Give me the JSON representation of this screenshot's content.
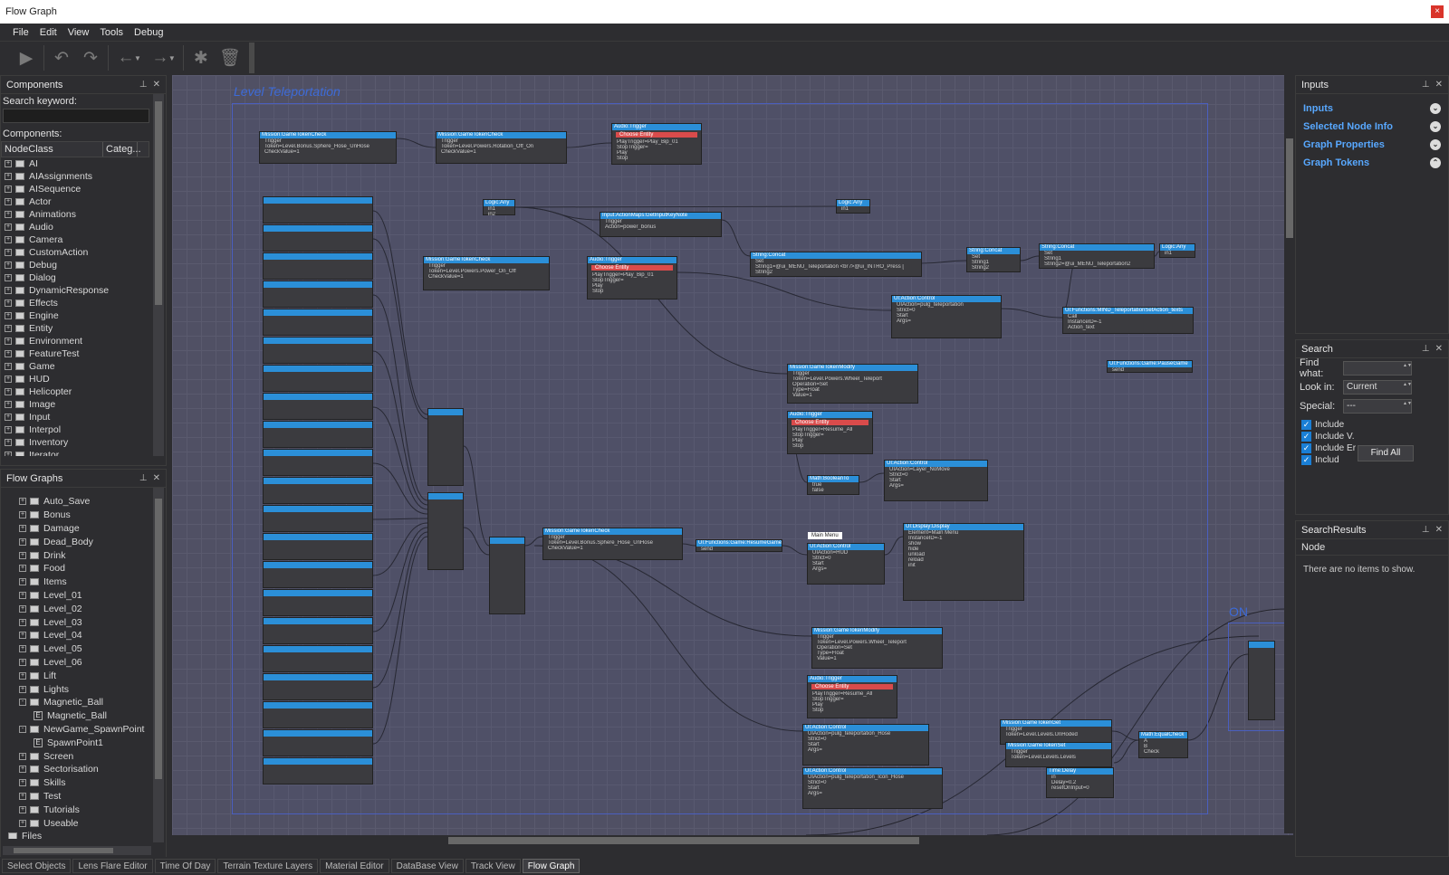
{
  "window": {
    "title": "Flow Graph",
    "close": "×"
  },
  "menu": [
    "File",
    "Edit",
    "View",
    "Tools",
    "Debug"
  ],
  "components_panel": {
    "title": "Components",
    "search_label": "Search keyword:",
    "list_label": "Components:",
    "columns": [
      "NodeClass",
      "Categ..."
    ],
    "items": [
      "AI",
      "AIAssignments",
      "AISequence",
      "Actor",
      "Animations",
      "Audio",
      "Camera",
      "CustomAction",
      "Debug",
      "Dialog",
      "DynamicResponse",
      "Effects",
      "Engine",
      "Entity",
      "Environment",
      "FeatureTest",
      "Game",
      "HUD",
      "Helicopter",
      "Image",
      "Input",
      "Interpol",
      "Inventory",
      "Iterator"
    ]
  },
  "flowgraphs_panel": {
    "title": "Flow Graphs",
    "items": [
      {
        "label": "Auto_Save",
        "level": 1,
        "state": "+"
      },
      {
        "label": "Bonus",
        "level": 1,
        "state": "+"
      },
      {
        "label": "Damage",
        "level": 1,
        "state": "+"
      },
      {
        "label": "Dead_Body",
        "level": 1,
        "state": "+"
      },
      {
        "label": "Drink",
        "level": 1,
        "state": "+"
      },
      {
        "label": "Food",
        "level": 1,
        "state": "+"
      },
      {
        "label": "Items",
        "level": 1,
        "state": "+"
      },
      {
        "label": "Level_01",
        "level": 1,
        "state": "+"
      },
      {
        "label": "Level_02",
        "level": 1,
        "state": "+"
      },
      {
        "label": "Level_03",
        "level": 1,
        "state": "+"
      },
      {
        "label": "Level_04",
        "level": 1,
        "state": "+"
      },
      {
        "label": "Level_05",
        "level": 1,
        "state": "+"
      },
      {
        "label": "Level_06",
        "level": 1,
        "state": "+"
      },
      {
        "label": "Lift",
        "level": 1,
        "state": "+"
      },
      {
        "label": "Lights",
        "level": 1,
        "state": "+"
      },
      {
        "label": "Magnetic_Ball",
        "level": 1,
        "state": "-"
      },
      {
        "label": "Magnetic_Ball",
        "level": 2,
        "state": "E"
      },
      {
        "label": "NewGame_SpawnPoint",
        "level": 1,
        "state": "-"
      },
      {
        "label": "SpawnPoint1",
        "level": 2,
        "state": "E"
      },
      {
        "label": "Screen",
        "level": 1,
        "state": "+"
      },
      {
        "label": "Sectorisation",
        "level": 1,
        "state": "+"
      },
      {
        "label": "Skills",
        "level": 1,
        "state": "+"
      },
      {
        "label": "Test",
        "level": 1,
        "state": "+"
      },
      {
        "label": "Tutorials",
        "level": 1,
        "state": "+"
      },
      {
        "label": "Useable",
        "level": 1,
        "state": "+"
      },
      {
        "label": "Files",
        "level": 0,
        "state": ""
      }
    ]
  },
  "canvas": {
    "group_title": "Level Teleportation",
    "group2_title": "ON",
    "note": "Main Menu",
    "nodes": [
      {
        "title": "Mission:GameTokenCheck",
        "ports": [
          "Trigger",
          "Token=Level.Bonus.Sphere_Hose_UnHose",
          "CheckValue=1"
        ]
      },
      {
        "title": "Mission:GameTokenCheck",
        "ports": [
          "Trigger",
          "Token=Level.Powers.Rotation_Off_On",
          "CheckValue=1"
        ]
      },
      {
        "title": "Audio:Trigger",
        "red": "Choose Entity",
        "ports": [
          "PlayTrigger=Play_Bip_01",
          "StopTrigger=",
          "Play",
          "Stop"
        ]
      },
      {
        "title": "Logic:Any",
        "ports": [
          "in1",
          "in2"
        ]
      },
      {
        "title": "Input:ActionMaps:GetInputKeyNote",
        "ports": [
          "Trigger",
          "Action=power_bonus"
        ]
      },
      {
        "title": "Logic:Any",
        "ports": [
          "in1"
        ]
      },
      {
        "title": "Mission:GameTokenCheck",
        "ports": [
          "Trigger",
          "Token=Level.Powers.Power_On_Off",
          "CheckValue=1"
        ]
      },
      {
        "title": "Audio:Trigger",
        "red": "Choose Entity",
        "ports": [
          "PlayTrigger=Play_Bip_01",
          "StopTrigger=",
          "Play",
          "Stop"
        ]
      },
      {
        "title": "String:Concat",
        "ports": [
          "Set",
          "String1=@ui_MENU_Teleportation <br />@ui_INTRO_Press [",
          "String2"
        ]
      },
      {
        "title": "String:Concat",
        "ports": [
          "Set",
          "String1",
          "String2"
        ]
      },
      {
        "title": "String:Concat",
        "ports": [
          "Set",
          "String1",
          "String2=@ui_MENU_Teleportation2"
        ]
      },
      {
        "title": "Logic:Any",
        "ports": [
          "in1"
        ]
      },
      {
        "title": "UI:Action:Control",
        "ports": [
          "UIAction=pulg_teleportation",
          "Strict=0",
          "Start",
          "Args="
        ]
      },
      {
        "title": "UI:Functions:MIND_TeleportationSetAction_texts",
        "ports": [
          "Call",
          "InstanceID=-1",
          "Action_text"
        ]
      },
      {
        "title": "UI:Functions:Game:PauseGame",
        "ports": [
          "send"
        ]
      },
      {
        "title": "Mission:GameTokenModify",
        "ports": [
          "Trigger",
          "Token=Level.Powers.Wheel_Teleport",
          "Operation=Set",
          "Type=Float",
          "Value=1"
        ]
      },
      {
        "title": "Audio:Trigger",
        "red": "Choose Entity",
        "ports": [
          "PlayTrigger=Resume_All",
          "StopTrigger=",
          "Play",
          "Stop"
        ]
      },
      {
        "title": "Math:BooleanTo",
        "ports": [
          "true",
          "false"
        ]
      },
      {
        "title": "UI:Action:Control",
        "ports": [
          "UIAction=Layer_NoMove",
          "Strict=0",
          "Start",
          "Args="
        ]
      },
      {
        "title": "Mission:GameTokenCheck",
        "ports": [
          "Trigger",
          "Token=Level.Bonus.Sphere_Hose_UnHose",
          "CheckValue=1"
        ]
      },
      {
        "title": "UI:Functions:Game:ResumeGame",
        "ports": [
          "send"
        ]
      },
      {
        "title": "UI:Action:Control",
        "ports": [
          "UIAction=HUD",
          "Strict=0",
          "Start",
          "Args="
        ]
      },
      {
        "title": "UI:Display:Display",
        "ports": [
          "Element=Main Menu",
          "InstanceID=-1",
          "show",
          "hide",
          "unload",
          "reload",
          "init"
        ]
      },
      {
        "title": "Mission:GameTokenModify",
        "ports": [
          "Trigger",
          "Token=Level.Powers.Wheel_Teleport",
          "Operation=Set",
          "Type=Float",
          "Value=1"
        ]
      },
      {
        "title": "Audio:Trigger",
        "red": "Choose Entity",
        "ports": [
          "PlayTrigger=Resume_All",
          "StopTrigger=",
          "Play",
          "Stop"
        ]
      },
      {
        "title": "UI:Action:Control",
        "ports": [
          "UIAction=pulg_teleportation_Hose",
          "Strict=0",
          "Start",
          "Args="
        ]
      },
      {
        "title": "UI:Action:Control",
        "ports": [
          "UIAction=pulg_teleportation_Icon_Hose",
          "Strict=0",
          "Start",
          "Args="
        ]
      },
      {
        "title": "Mission:GameTokenGet",
        "ports": [
          "Trigger",
          "Token=Level.Levels.UnHoded"
        ]
      },
      {
        "title": "Mission:GameTokenSet",
        "ports": [
          "Trigger",
          "Token=Level.Levels.Levels"
        ]
      },
      {
        "title": "Time:Delay",
        "ports": [
          "in",
          "Delay=0.2",
          "resetOnInput=0"
        ]
      },
      {
        "title": "Math:EqualCheck",
        "ports": [
          "A",
          "B",
          "Check"
        ]
      }
    ]
  },
  "inputs_panel": {
    "title": "Inputs",
    "links": [
      "Inputs",
      "Selected Node Info",
      "Graph Properties",
      "Graph Tokens"
    ]
  },
  "search_panel": {
    "title": "Search",
    "find_label": "Find what:",
    "find_value": "",
    "lookin_label": "Look in:",
    "lookin_value": "Current",
    "special_label": "Special:",
    "special_value": "---",
    "checks": [
      "Include",
      "Include V.",
      "Include Er",
      "Includ"
    ],
    "find_all": "Find All"
  },
  "results_panel": {
    "title": "SearchResults",
    "column": "Node",
    "empty": "There are no items to show."
  },
  "bottom_tabs": [
    "Select Objects",
    "Lens Flare Editor",
    "Time Of Day",
    "Terrain Texture Layers",
    "Material Editor",
    "DataBase View",
    "Track View",
    "Flow Graph"
  ],
  "active_tab": "Flow Graph",
  "colors": {
    "node_header": "#2b8fd8",
    "node_red": "#d94b4b",
    "group_border": "#4a5fbf",
    "link": "#58a8ff"
  }
}
